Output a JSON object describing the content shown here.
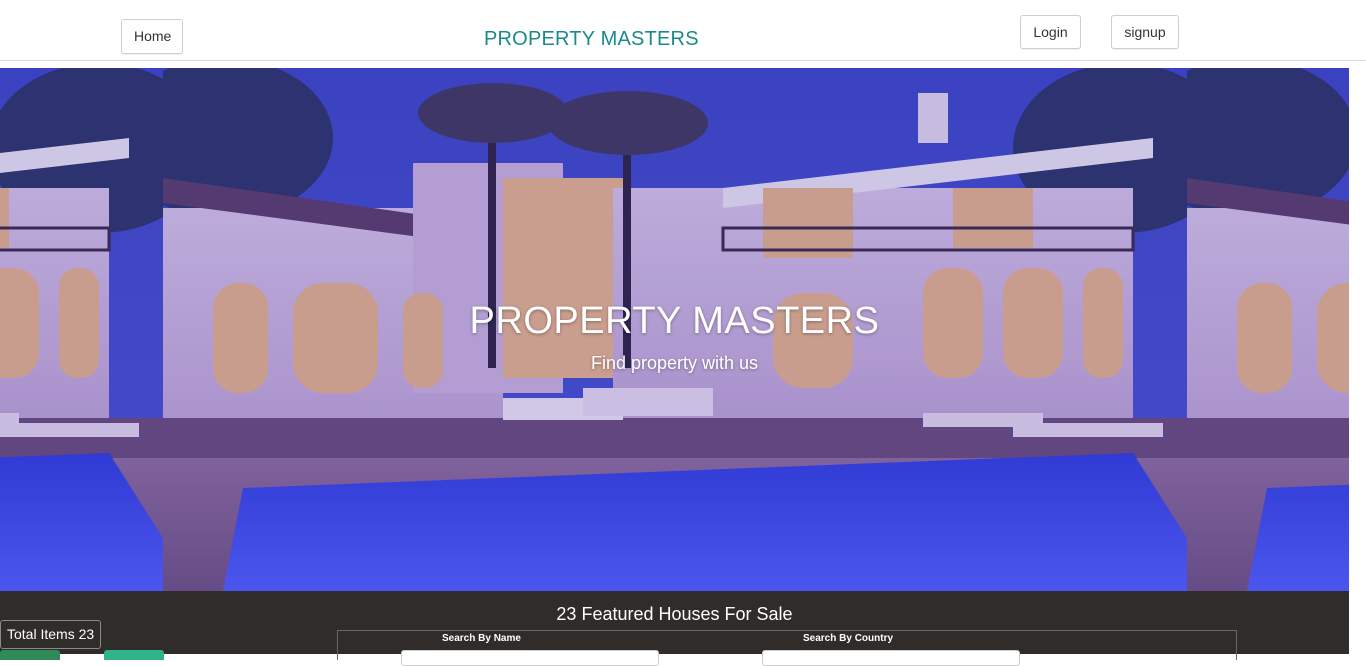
{
  "navbar": {
    "home_label": "Home",
    "brand": "PROPERTY MASTERS",
    "login_label": "Login",
    "signup_label": "signup"
  },
  "hero": {
    "title": "PROPERTY MASTERS",
    "subtitle": "Find property with us",
    "image": "luxury-villa-with-pool-at-dusk"
  },
  "featured": {
    "title": "23 Featured Houses For Sale",
    "total_items": "Total Items 23",
    "search": {
      "name_label": "Search By Name",
      "country_label": "Search By Country",
      "name_value": "",
      "country_value": ""
    }
  },
  "colors": {
    "brand": "#1a8a8a",
    "featured_bg": "#2f2c2a"
  }
}
